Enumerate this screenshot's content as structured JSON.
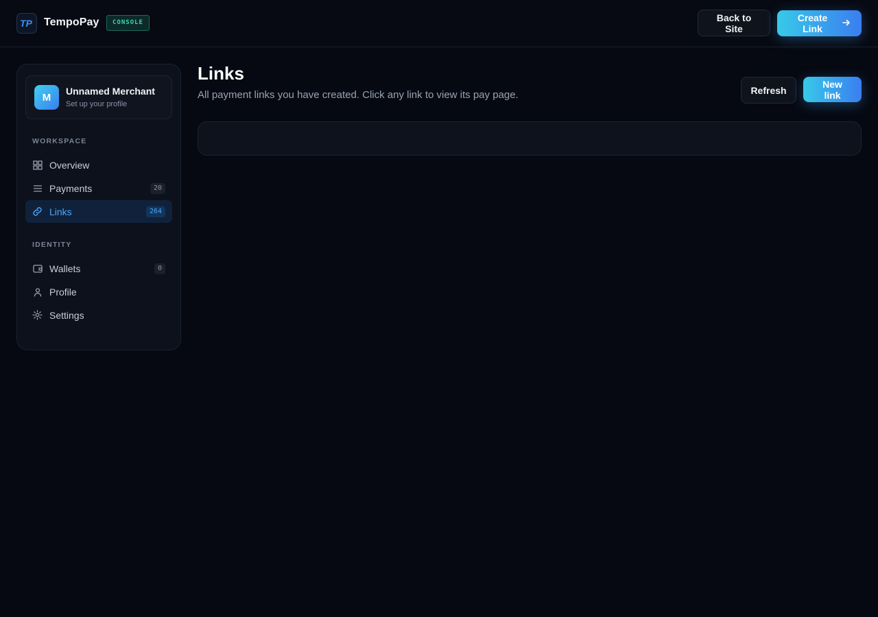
{
  "header": {
    "logo_text": "TP",
    "brand": "TempoPay",
    "badge": "CONSOLE",
    "back_label": "Back to Site",
    "create_label": "Create Link"
  },
  "merchant": {
    "initial": "M",
    "name": "Unnamed Merchant",
    "subtitle": "Set up your profile"
  },
  "sidebar": {
    "workspace_label": "WORKSPACE",
    "identity_label": "IDENTITY",
    "workspace_items": [
      {
        "label": "Overview",
        "icon": "grid-icon",
        "count": null
      },
      {
        "label": "Payments",
        "icon": "list-icon",
        "count": "20"
      },
      {
        "label": "Links",
        "icon": "link-icon",
        "count": "264",
        "active": true
      }
    ],
    "identity_items": [
      {
        "label": "Wallets",
        "icon": "wallet-icon",
        "count": "0"
      },
      {
        "label": "Profile",
        "icon": "user-icon",
        "count": null
      },
      {
        "label": "Settings",
        "icon": "gear-icon",
        "count": null
      }
    ]
  },
  "main": {
    "title": "Links",
    "subtitle": "All payment links you have created. Click any link to view its pay page.",
    "refresh_label": "Refresh",
    "new_link_label": "New link"
  },
  "colors": {
    "background": "#060912",
    "accent": "#4aa8ff",
    "gradient_start": "#38c9e8",
    "gradient_end": "#3a7ef0",
    "badge_text": "#3fd3b6"
  }
}
